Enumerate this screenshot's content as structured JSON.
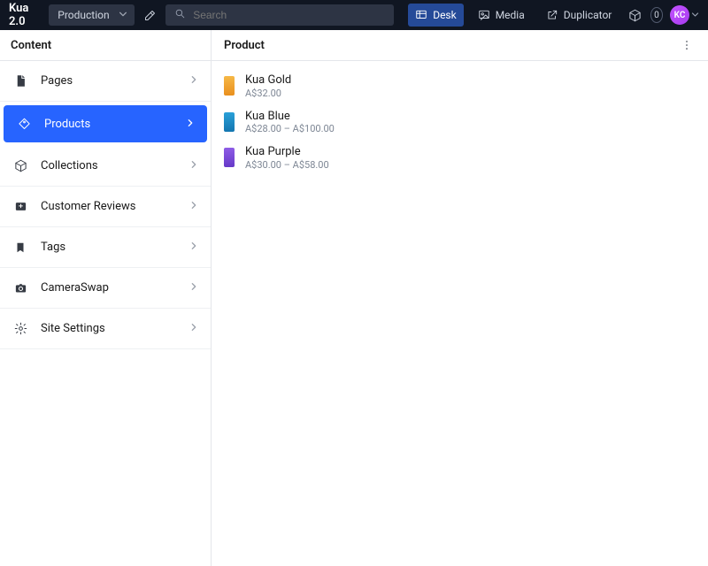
{
  "navbar": {
    "brand": "Kua 2.0",
    "environment": "Production",
    "search_placeholder": "Search",
    "tools": {
      "desk": "Desk",
      "media": "Media",
      "duplicator": "Duplicator"
    },
    "badge_count": "0",
    "avatar_initials": "KC"
  },
  "sidebar": {
    "title": "Content",
    "items": [
      {
        "label": "Pages"
      },
      {
        "label": "Products"
      },
      {
        "label": "Collections"
      },
      {
        "label": "Customer Reviews"
      },
      {
        "label": "Tags"
      },
      {
        "label": "CameraSwap"
      },
      {
        "label": "Site Settings"
      }
    ]
  },
  "content": {
    "title": "Product",
    "products": [
      {
        "name": "Kua Gold",
        "price": "A$32.00"
      },
      {
        "name": "Kua Blue",
        "price": "A$28.00 – A$100.00"
      },
      {
        "name": "Kua Purple",
        "price": "A$30.00 – A$58.00"
      }
    ]
  }
}
